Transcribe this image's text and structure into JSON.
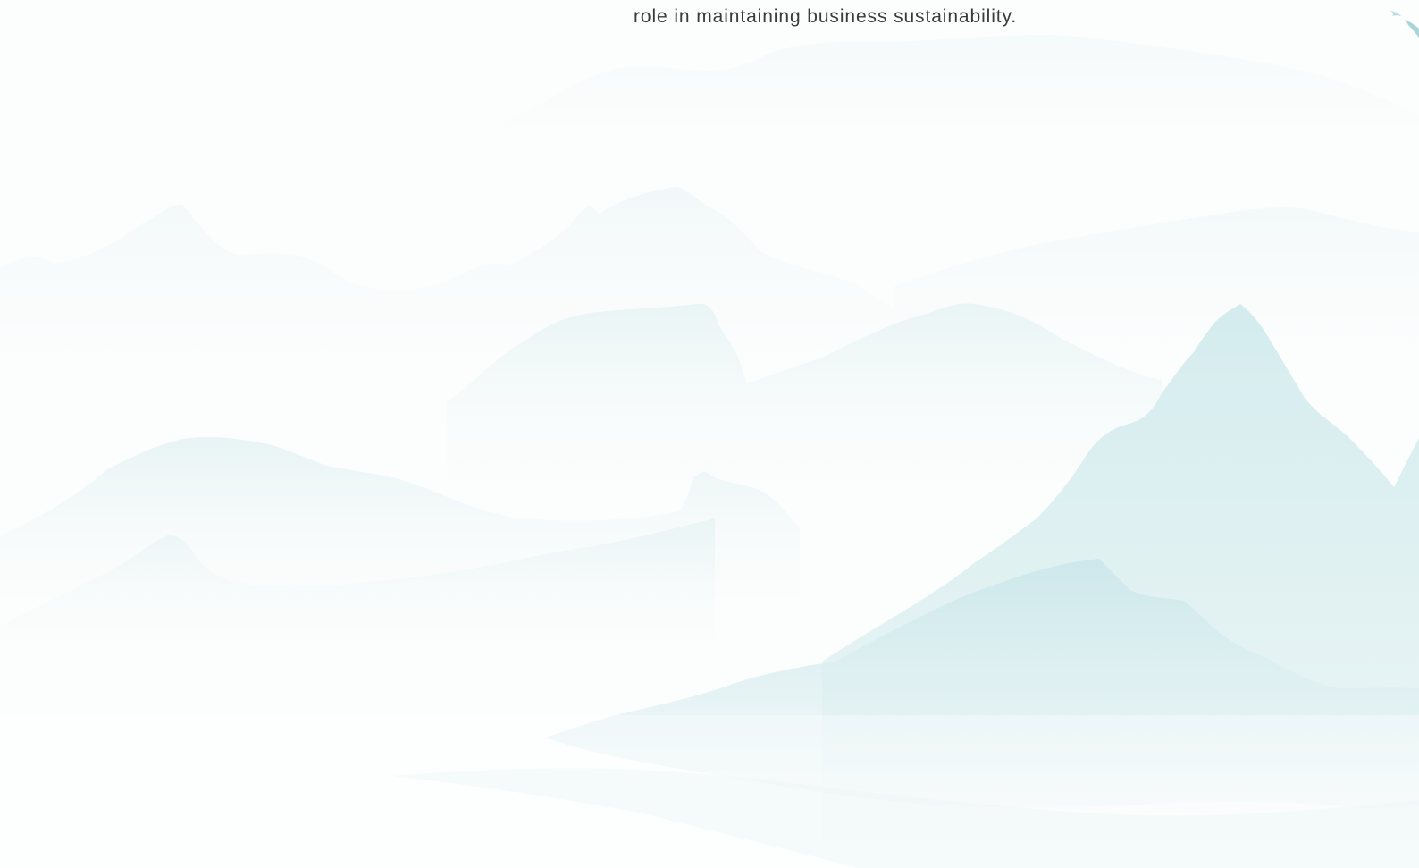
{
  "content": {
    "caption_text": "role in maintaining business sustainability."
  },
  "background": {
    "illustration": "misty-mountains-illustration",
    "colors": {
      "paper": "#fcfdfd",
      "mist_far": "#eef6f7",
      "mist_mid": "#e2f1f3",
      "peak_near": "#cfe9ec",
      "text": "#3a3a3a"
    }
  },
  "decoration": {
    "icon": "bird-icon"
  }
}
